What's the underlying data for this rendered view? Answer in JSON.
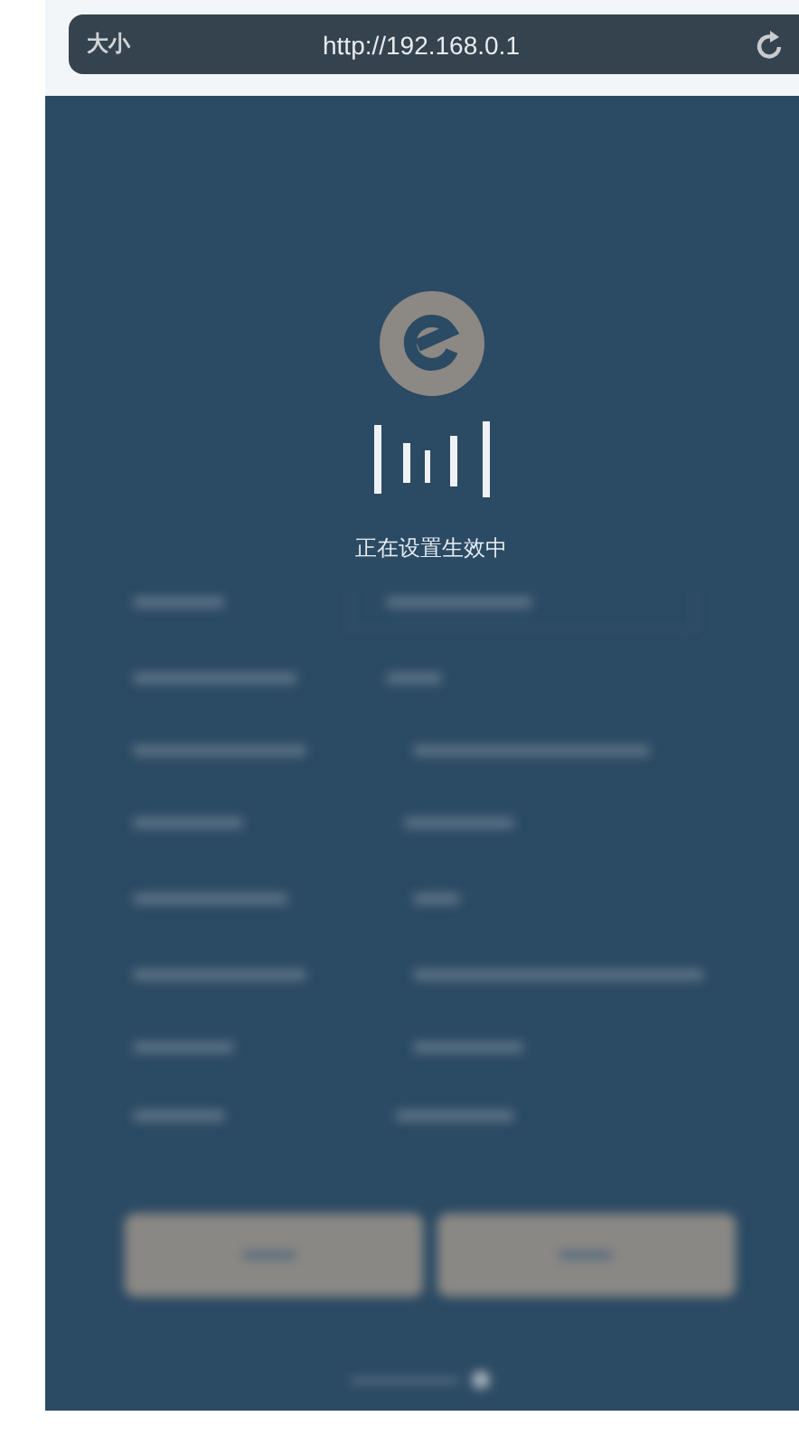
{
  "browser_bar": {
    "text_size": "大小",
    "url": "http://192.168.0.1"
  },
  "status": {
    "message": "正在设置生效中"
  }
}
